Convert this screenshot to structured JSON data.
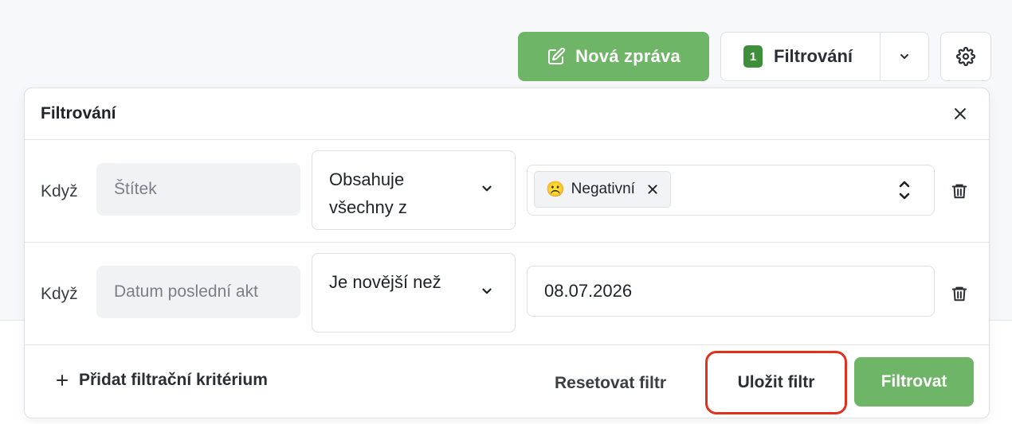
{
  "toolbar": {
    "new_message_label": "Nová zpráva",
    "filter_count": "1",
    "filter_label": "Filtrování"
  },
  "panel": {
    "title": "Filtrování",
    "rows": [
      {
        "prefix": "Když",
        "field": "Štítek",
        "operator": "Obsahuje všechny z",
        "chips": [
          {
            "emoji": "☹️",
            "label": "Negativní"
          }
        ]
      },
      {
        "prefix": "Když",
        "field": "Datum poslední akt",
        "operator": "Je novější než",
        "value": "08.07.2026"
      }
    ],
    "add_criterion_label": "Přidat filtrační kritérium",
    "reset_label": "Resetovat filtr",
    "save_label": "Uložit filtr",
    "apply_label": "Filtrovat"
  },
  "colors": {
    "primary_green": "#6fb567",
    "badge_green": "#3f8f3a",
    "highlight_red": "#e3301e"
  }
}
